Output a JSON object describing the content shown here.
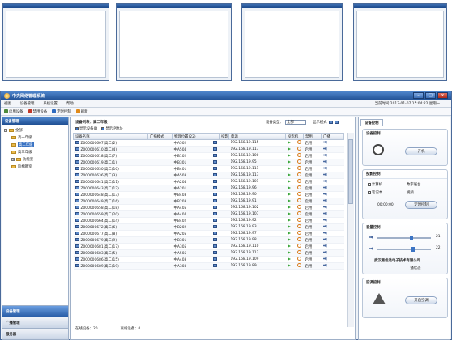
{
  "app": {
    "title": "中央网络管理系统"
  },
  "menu": [
    "视图",
    "设备管理",
    "系统设置",
    "帮助"
  ],
  "clock": "当前时间:2013-01-07 15:04:22 星期一",
  "toolbar": [
    "启用设备",
    "禁用设备",
    "定时控制",
    "刷新"
  ],
  "left": {
    "header": "设备管理",
    "tree": [
      {
        "label": "全部",
        "level": 0,
        "expander": "-"
      },
      {
        "label": "高一年级",
        "level": 1
      },
      {
        "label": "高二年级",
        "level": 1,
        "selected": true
      },
      {
        "label": "高三年级",
        "level": 1
      },
      {
        "label": "功能室",
        "level": 1,
        "expander": "+"
      },
      {
        "label": "阶梯教室",
        "level": 1
      }
    ],
    "nav": [
      {
        "label": "设备管理",
        "active": true
      },
      {
        "label": "广播管理"
      },
      {
        "label": "服务器"
      }
    ]
  },
  "center": {
    "crumb_prefix": "设备列表：",
    "crumb_value": "高二年级",
    "opt_show_id": "显示设备ID",
    "opt_show_ip": "显示IP地址",
    "devtype_label": "设备类型：",
    "devtype_value": "全部",
    "display_mode_label": "显示模式",
    "columns": [
      "设备名称",
      "广播模式",
      "物理位置(22)",
      "",
      "投影",
      "电源",
      "投影机",
      "禁用",
      "广播"
    ],
    "rows": [
      {
        "name": "Z000000607 高二(2)",
        "loc": "中A502",
        "ip": "192.168.19.115",
        "status": "启用"
      },
      {
        "name": "Z000000610 高二(4)",
        "loc": "中A504",
        "ip": "192.168.19.117",
        "status": "启用"
      },
      {
        "name": "Z000000618 高二(7)",
        "loc": "中B102",
        "ip": "192.168.19.100",
        "status": "启用"
      },
      {
        "name": "Z000000619 高二(1)",
        "loc": "中B301",
        "ip": "192.168.19.95",
        "status": "启用"
      },
      {
        "name": "Z000000630 高二(10)",
        "loc": "中B401",
        "ip": "192.168.19.111",
        "status": "启用"
      },
      {
        "name": "Z000000636 高二(3)",
        "loc": "中A503",
        "ip": "192.168.19.113",
        "status": "启用"
      },
      {
        "name": "Z000000641 高二(11)",
        "loc": "中A204",
        "ip": "192.168.19.101",
        "status": "启用"
      },
      {
        "name": "Z000000643 高二(12)",
        "loc": "中A201",
        "ip": "192.168.19.96",
        "status": "启用"
      },
      {
        "name": "Z000000648 高二(13)",
        "loc": "中B403",
        "ip": "192.168.19.90",
        "status": "启用"
      },
      {
        "name": "Z000000649 高二(16)",
        "loc": "中B203",
        "ip": "192.168.19.91",
        "status": "启用"
      },
      {
        "name": "Z000000658 高二(18)",
        "loc": "中A405",
        "ip": "192.168.19.102",
        "status": "启用"
      },
      {
        "name": "Z000000659 高二(20)",
        "loc": "中A404",
        "ip": "192.168.19.107",
        "status": "启用"
      },
      {
        "name": "Z000000664 高二(14)",
        "loc": "中B402",
        "ip": "192.168.19.92",
        "status": "启用"
      },
      {
        "name": "Z000000672 高二(6)",
        "loc": "中B202",
        "ip": "192.168.19.93",
        "status": "启用"
      },
      {
        "name": "Z000000677 高二(8)",
        "loc": "中A205",
        "ip": "192.168.19.97",
        "status": "启用"
      },
      {
        "name": "Z000000679 高二(9)",
        "loc": "中B301",
        "ip": "192.168.19.98",
        "status": "启用"
      },
      {
        "name": "Z000000681 高二(17)",
        "loc": "中A305",
        "ip": "192.168.19.110",
        "status": "启用"
      },
      {
        "name": "Z000000683 高二(5)",
        "loc": "中A505",
        "ip": "192.168.19.112",
        "status": "启用"
      },
      {
        "name": "Z000000686 高二(15)",
        "loc": "中A403",
        "ip": "192.168.19.109",
        "status": "启用"
      },
      {
        "name": "Z000000689 高二(19)",
        "loc": "中A303",
        "ip": "192.168.19.89",
        "status": "启用"
      }
    ],
    "status_online": "在线设备：20",
    "status_offline": "离线设备：0"
  },
  "right": {
    "tab": "设备控制",
    "p1": {
      "title": "设备控制",
      "btn": "开机"
    },
    "p2": {
      "title": "投影控制",
      "opt1": "计算机",
      "opt2": "笔记本",
      "opt3": "数字展台",
      "opt4": "视频",
      "time": "00:00:00",
      "btn": "定时控制"
    },
    "p3": {
      "title": "音量控制",
      "vol1": "21",
      "vol2": "22",
      "vendor": "厂播状态",
      "vendor_title": "武汉易佳达电子技术有限公司"
    },
    "p4": {
      "title": "空调控制",
      "btn": "开启空调"
    }
  }
}
